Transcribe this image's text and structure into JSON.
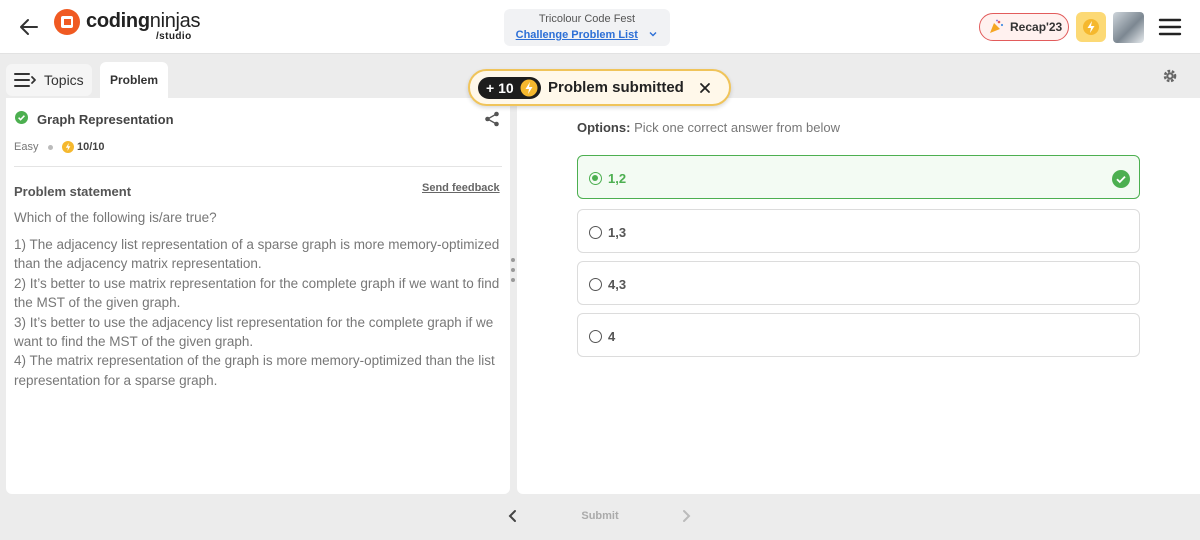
{
  "header": {
    "logo_text_bold": "coding",
    "logo_text_light": "ninjas",
    "logo_sub": "/studio",
    "event_title": "Tricolour Code Fest",
    "event_link": "Challenge Problem List",
    "recap_label": "Recap'23"
  },
  "tabs": {
    "topics_label": "Topics",
    "problem_label": "Problem"
  },
  "problem": {
    "title": "Graph Representation",
    "difficulty": "Easy",
    "score": "10/10",
    "statement_heading": "Problem statement",
    "feedback_label": "Send feedback",
    "question": "Which of the following is/are true?",
    "statements": [
      "1) The adjacency list representation of a sparse graph is more memory-optimized than the adjacency matrix representation.",
      "2) It’s better to use matrix representation for the complete graph if we want to find the MST of the given graph.",
      "3) It’s better to use the adjacency list representation for the complete graph if we want to find the MST of the given graph.",
      "4) The matrix representation of the graph is more memory-optimized than the list representation for a sparse graph."
    ]
  },
  "options": {
    "label": "Options:",
    "hint": "Pick one correct answer from below",
    "items": [
      {
        "label": "1,2",
        "selected": true,
        "correct": true
      },
      {
        "label": "1,3",
        "selected": false,
        "correct": false
      },
      {
        "label": "4,3",
        "selected": false,
        "correct": false
      },
      {
        "label": "4",
        "selected": false,
        "correct": false
      }
    ]
  },
  "toast": {
    "points": "+ 10",
    "message": "Problem submitted"
  },
  "footer": {
    "submit_label": "Submit"
  },
  "colors": {
    "brand": "#f05a22",
    "success": "#4caf50",
    "link": "#2c6fd6",
    "coin": "#f5b82e"
  }
}
